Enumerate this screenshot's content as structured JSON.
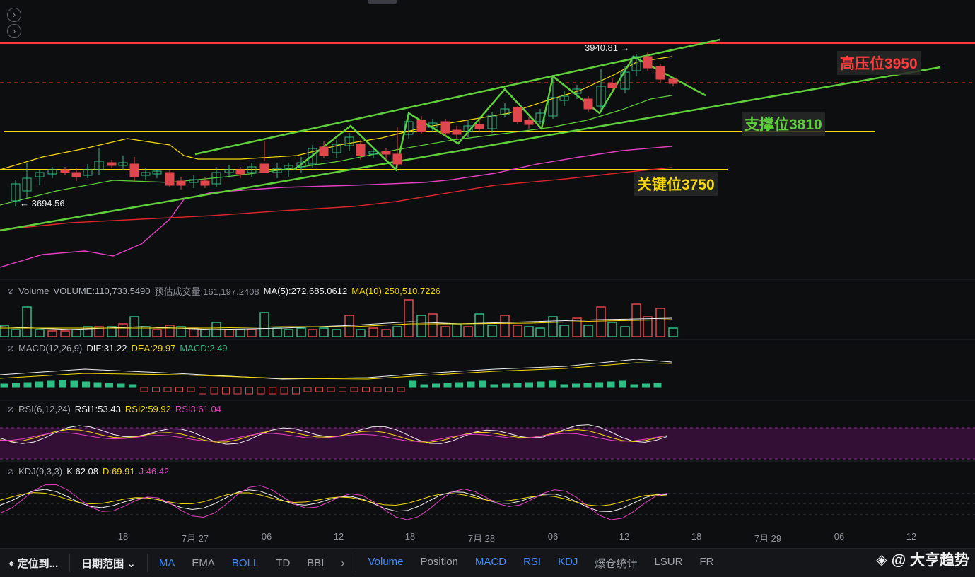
{
  "nav": {
    "up_icon": "chevron-right-circle-icon",
    "down_icon": "chevron-right-circle-icon"
  },
  "annotations": {
    "high_price": "3940.81 →",
    "low_price": "← 3694.56",
    "resistance": "高压位3950",
    "support": "支撑位3810",
    "key_level": "关键位3750"
  },
  "colors": {
    "up": "#2ebd85",
    "down": "#e0474c",
    "resistance": "#ff3b3b",
    "support": "#5fd03a",
    "key": "#f5d90a",
    "trend": "#5fd03a"
  },
  "volume": {
    "name": "Volume",
    "volume": "VOLUME:110,733.5490",
    "est": "预估成交量:161,197.2408",
    "ma5": "MA(5):272,685.0612",
    "ma10": "MA(10):250,510.7226"
  },
  "macd": {
    "name": "MACD(12,26,9)",
    "dif": "DIF:31.22",
    "dea": "DEA:29.97",
    "macd": "MACD:2.49"
  },
  "rsi": {
    "name": "RSI(6,12,24)",
    "rsi1": "RSI1:53.43",
    "rsi2": "RSI2:59.92",
    "rsi3": "RSI3:61.04"
  },
  "kdj": {
    "name": "KDJ(9,3,3)",
    "k": "K:62.08",
    "d": "D:69.91",
    "j": "J:46.42"
  },
  "xaxis": [
    "18",
    "7月 27",
    "06",
    "12",
    "18",
    "7月 28",
    "06",
    "12",
    "18",
    "7月 29",
    "06",
    "12"
  ],
  "toolbar": {
    "locate": "定位到...",
    "range": "日期范围",
    "overlays": [
      "MA",
      "EMA",
      "BOLL",
      "TD",
      "BBI"
    ],
    "overlays_active": [
      "MA",
      "BOLL"
    ],
    "indicators": [
      "Volume",
      "Position",
      "MACD",
      "RSI",
      "KDJ",
      "爆仓统计",
      "LSUR",
      "FR"
    ],
    "indicators_active": [
      "Volume",
      "MACD",
      "RSI",
      "KDJ"
    ]
  },
  "watermark": "@ 大亨趋势"
}
